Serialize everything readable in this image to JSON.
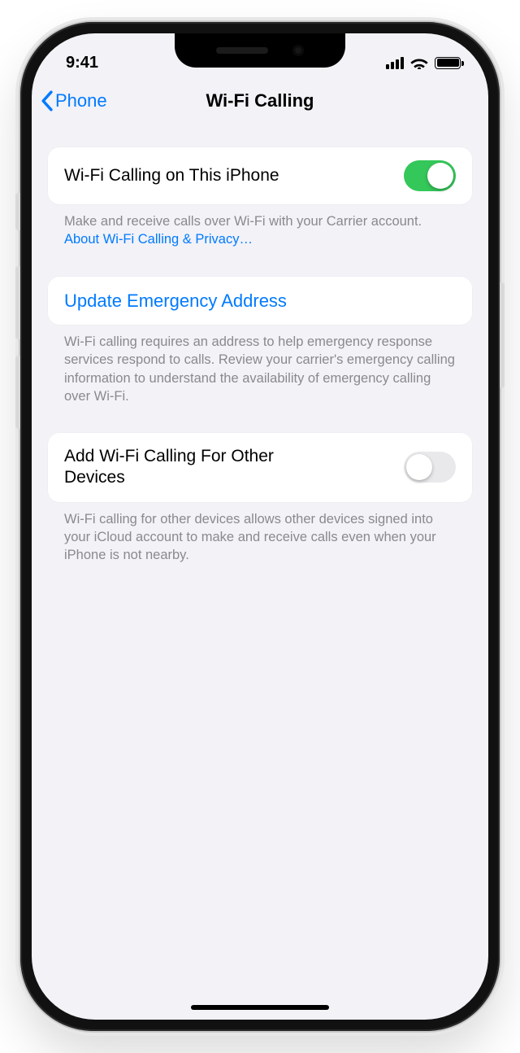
{
  "status": {
    "time": "9:41"
  },
  "nav": {
    "back_label": "Phone",
    "title": "Wi-Fi Calling"
  },
  "sections": {
    "wifi_calling": {
      "label": "Wi-Fi Calling on This iPhone",
      "enabled": true,
      "footer_text": "Make and receive calls over Wi-Fi with your Carrier account. ",
      "footer_link": "About Wi-Fi Calling & Privacy…"
    },
    "emergency": {
      "label": "Update Emergency Address",
      "footer_text": "Wi-Fi calling requires an address to help emergency response services respond to calls. Review your carrier's emergency calling information to understand the availability of emergency calling over Wi-Fi."
    },
    "other_devices": {
      "label": "Add Wi-Fi Calling For Other Devices",
      "enabled": false,
      "footer_text": "Wi-Fi calling for other devices allows other devices signed into your iCloud account to make and receive calls even when your iPhone is not nearby."
    }
  },
  "colors": {
    "accent": "#007aff",
    "switch_on": "#34c759",
    "bg": "#f2f2f7",
    "secondary_text": "#8a8a8e"
  }
}
